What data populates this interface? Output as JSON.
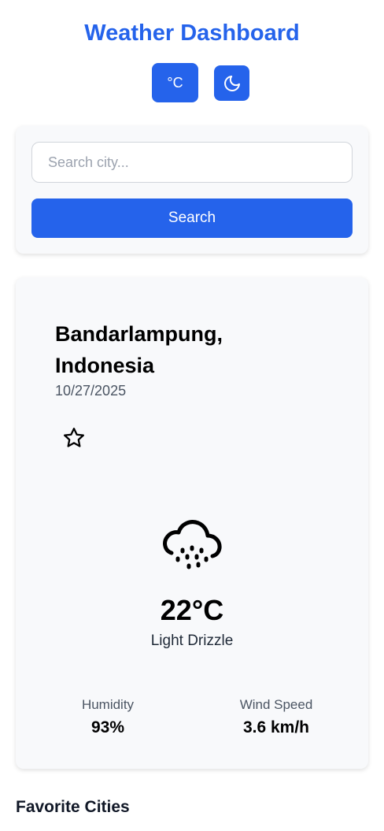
{
  "app": {
    "title": "Weather Dashboard"
  },
  "toolbar": {
    "unit_label": "°C",
    "theme_icon": "moon-icon"
  },
  "search": {
    "placeholder": "Search city...",
    "value": "",
    "button_label": "Search"
  },
  "weather": {
    "city": "Bandarlampung, Indonesia",
    "date": "10/27/2025",
    "favorite_icon": "star-outline-icon",
    "condition_icon": "cloud-drizzle-icon",
    "temperature": "22°C",
    "condition": "Light Drizzle",
    "humidity": {
      "label": "Humidity",
      "value": "93%"
    },
    "wind": {
      "label": "Wind Speed",
      "value": "3.6 km/h"
    }
  },
  "favorites": {
    "heading": "Favorite Cities"
  },
  "colors": {
    "accent": "#2563eb",
    "card_bg": "#f8f9fb"
  }
}
